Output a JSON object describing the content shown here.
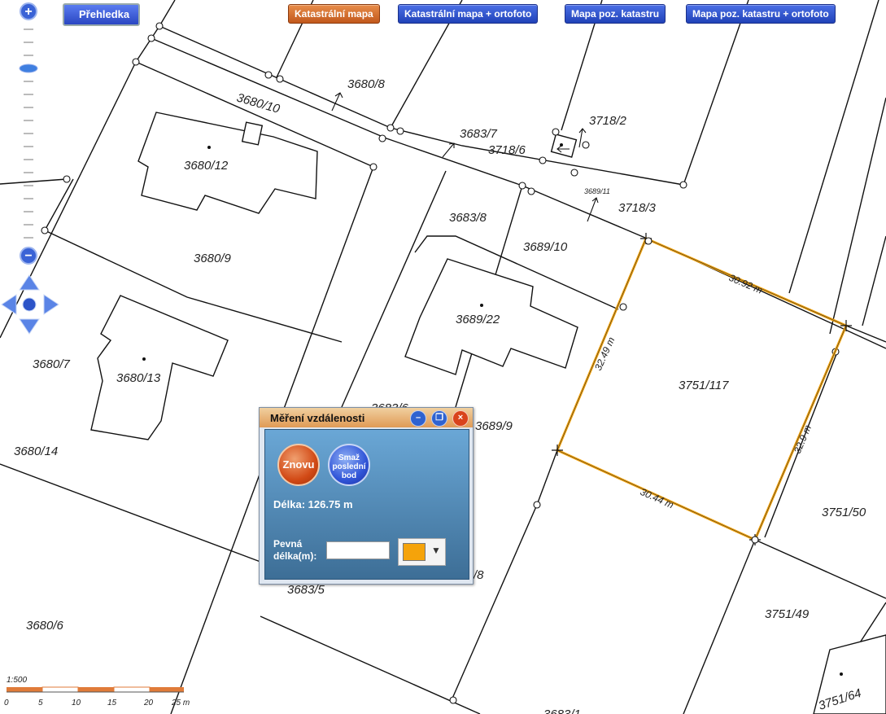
{
  "toolbar": {
    "overview_label": "Přehledka",
    "layers": [
      {
        "label": "Katastrální mapa",
        "active": true
      },
      {
        "label": "Katastrální mapa + ortofoto",
        "active": false
      },
      {
        "label": "Mapa poz. katastru",
        "active": false
      },
      {
        "label": "Mapa poz. katastru + ortofoto",
        "active": false
      }
    ]
  },
  "zoom": {
    "in_label": "+",
    "out_label": "−"
  },
  "parcels": [
    "3680/8",
    "3680/10",
    "3680/12",
    "3683/7",
    "3718/6",
    "3718/2",
    "3689/11",
    "3718/3",
    "3683/8",
    "3689/10",
    "3680/9",
    "3689/22",
    "3751/117",
    "3680/7",
    "3680/13",
    "3683/6",
    "3689/9",
    "3680/14",
    "3751/50",
    "3683/5",
    "/8",
    "3751/49",
    "3680/6",
    "3751/64",
    "3683/1"
  ],
  "measure": {
    "segments": [
      "30.92 m",
      "32.49 m",
      "32.9 m",
      "30.44 m"
    ],
    "line_color": "#f5a30a"
  },
  "dialog": {
    "title": "Měření vzdálenosti",
    "again_label": "Znovu",
    "delete_label": "Smaž poslední bod",
    "length_text": "Délka: 126.75 m",
    "fixed_label_1": "Pevná",
    "fixed_label_2": "délka(m):",
    "fixed_value": "",
    "color": "#f5a30a"
  },
  "scale": {
    "ratio": "1:500",
    "ticks": [
      "0",
      "5",
      "10",
      "15",
      "20",
      "25 m"
    ]
  }
}
